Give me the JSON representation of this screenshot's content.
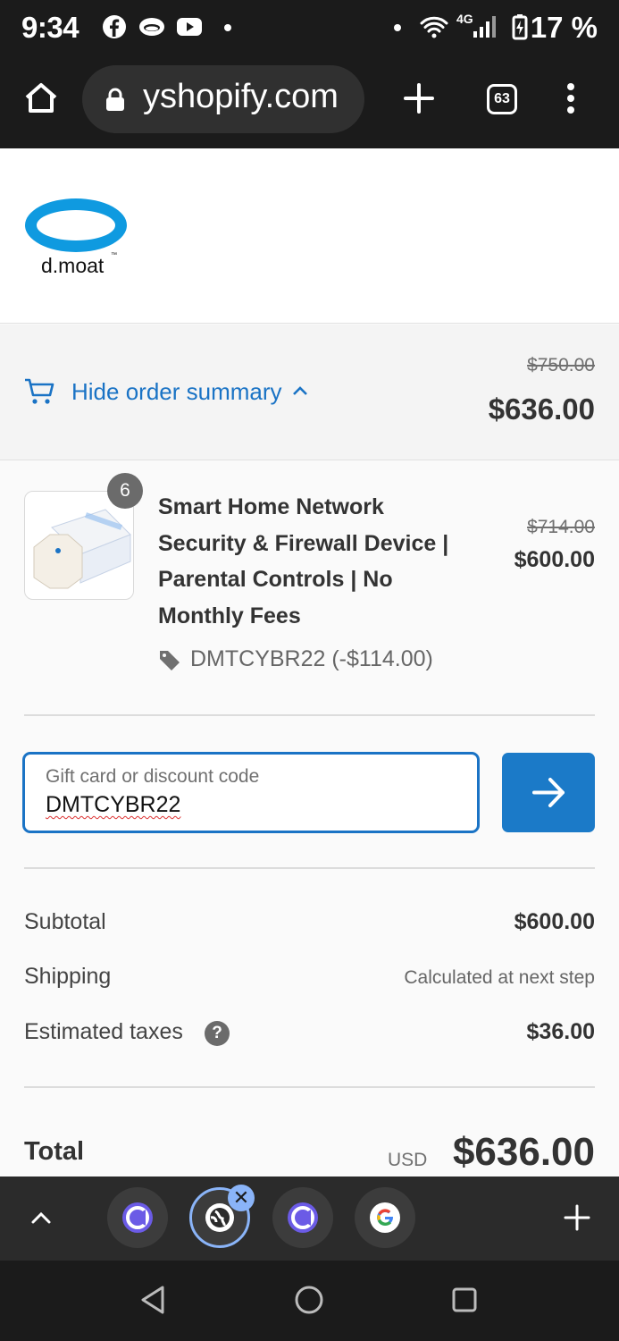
{
  "status_bar": {
    "time": "9:34",
    "network": "4G",
    "battery": "17 %",
    "icons": [
      "facebook-icon",
      "messenger-icon",
      "youtube-icon",
      "dot-icon",
      "dot-icon",
      "wifi-icon",
      "signal-icon",
      "battery-charging-icon"
    ]
  },
  "browser": {
    "url": "yshopify.com",
    "tab_count": "63",
    "icons": [
      "home-icon",
      "lock-icon",
      "new-tab-icon",
      "more-vert-icon"
    ]
  },
  "brand": {
    "logo_text": "d.moat",
    "logo_tm": "™",
    "logo_color": "#0f9ae0"
  },
  "order_summary": {
    "toggle_label": "Hide order summary",
    "original_total": "$750.00",
    "total": "$636.00",
    "accent_color": "#1a73c5"
  },
  "product": {
    "quantity": "6",
    "title": "Smart Home Network Security & Firewall Device | Parental Controls | No Monthly Fees",
    "original_price": "$714.00",
    "price": "$600.00",
    "discount": "DMTCYBR22 (-$114.00)"
  },
  "discount_form": {
    "placeholder": "Gift card or discount code",
    "value": "DMTCYBR22",
    "button_icon": "arrow-right-icon"
  },
  "costs": {
    "subtotal_label": "Subtotal",
    "subtotal": "$600.00",
    "shipping_label": "Shipping",
    "shipping": "Calculated at next step",
    "taxes_label": "Estimated taxes",
    "taxes": "$36.00",
    "help": "?"
  },
  "total": {
    "label": "Total",
    "currency": "USD",
    "amount": "$636.00"
  },
  "tab_strip": {
    "tabs": [
      "copilot-tab",
      "globe-tab-active",
      "copilot-tab",
      "google-tab"
    ],
    "close": "✕"
  },
  "nav": [
    "back-icon",
    "home-circle-icon",
    "recents-icon"
  ]
}
